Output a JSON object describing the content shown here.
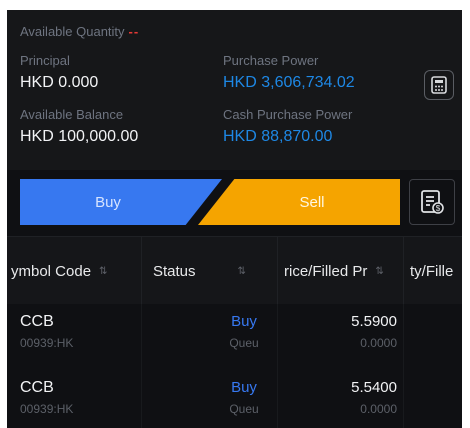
{
  "account": {
    "available_quantity_label": "Available Quantity",
    "available_quantity_value": "--",
    "principal_label": "Principal",
    "principal_value": "HKD 0.000",
    "purchase_power_label": "Purchase Power",
    "purchase_power_value": "HKD 3,606,734.02",
    "available_balance_label": "Available Balance",
    "available_balance_value": "HKD 100,000.00",
    "cash_purchase_power_label": "Cash Purchase Power",
    "cash_purchase_power_value": "HKD 88,870.00"
  },
  "actions": {
    "buy_label": "Buy",
    "sell_label": "Sell"
  },
  "table": {
    "columns": [
      "ymbol Code",
      "Status",
      "rice/Filled Pr",
      "ty/Fille"
    ],
    "rows": [
      {
        "name": "CCB",
        "code": "00939:HK",
        "side": "Buy",
        "status": "Queu",
        "price": "5.5900",
        "filled": "0.0000"
      },
      {
        "name": "CCB",
        "code": "00939:HK",
        "side": "Buy",
        "status": "Queu",
        "price": "5.5400",
        "filled": "0.0000"
      }
    ]
  },
  "colors": {
    "buy": "#3778f0",
    "sell": "#f5a400",
    "value_blue": "#1e88e5",
    "dash_red": "#e53935",
    "background": "#0f1013"
  },
  "icons": {
    "calculator": "calculator-icon",
    "order_list": "order-list-icon",
    "sort": "sort-icon"
  }
}
